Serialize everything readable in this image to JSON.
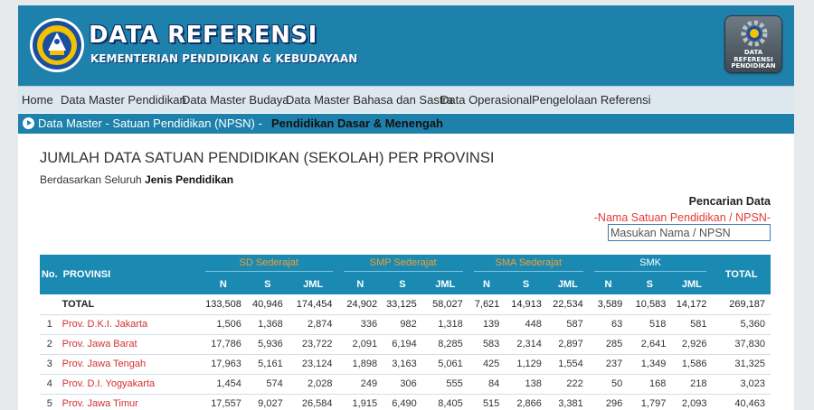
{
  "header": {
    "title": "DATA REFERENSI",
    "subtitle": "KEMENTERIAN PENDIDIKAN & KEBUDAYAAN",
    "badge_lines": [
      "DATA",
      "REFERENSI",
      "PENDIDIKAN"
    ]
  },
  "nav": {
    "items": [
      "Home",
      "Data Master Pendidikan",
      "Data Master Budaya",
      "Data Master Bahasa dan Sastra",
      "Data Operasional",
      "Pengelolaan Referensi"
    ]
  },
  "breadcrumb": {
    "path": "Data Master - Satuan Pendidikan (NPSN) -",
    "current": "Pendidikan Dasar & Menengah"
  },
  "main": {
    "heading": "JUMLAH DATA SATUAN PENDIDIKAN (SEKOLAH) PER PROVINSI",
    "sub_prefix": "Berdasarkan Seluruh",
    "sub_bold": "Jenis Pendidikan"
  },
  "search": {
    "title": "Pencarian Data",
    "subtitle": "-Nama Satuan Pendidikan / NPSN-",
    "placeholder": "Masukan Nama / NPSN"
  },
  "table": {
    "col_no": "No.",
    "col_prov": "PROVINSI",
    "groups": [
      "SD Sederajat",
      "SMP Sederajat",
      "SMA Sederajat",
      "SMK"
    ],
    "sub_cols": [
      "N",
      "S",
      "JML"
    ],
    "col_total": "TOTAL",
    "total_row": {
      "no": "",
      "prov": "TOTAL",
      "values": [
        "133,508",
        "40,946",
        "174,454",
        "24,902",
        "33,125",
        "58,027",
        "7,621",
        "14,913",
        "22,534",
        "3,589",
        "10,583",
        "14,172",
        "269,187"
      ]
    },
    "rows": [
      {
        "no": "1",
        "prov": "Prov. D.K.I. Jakarta",
        "values": [
          "1,506",
          "1,368",
          "2,874",
          "336",
          "982",
          "1,318",
          "139",
          "448",
          "587",
          "63",
          "518",
          "581",
          "5,360"
        ]
      },
      {
        "no": "2",
        "prov": "Prov. Jawa Barat",
        "values": [
          "17,786",
          "5,936",
          "23,722",
          "2,091",
          "6,194",
          "8,285",
          "583",
          "2,314",
          "2,897",
          "285",
          "2,641",
          "2,926",
          "37,830"
        ]
      },
      {
        "no": "3",
        "prov": "Prov. Jawa Tengah",
        "values": [
          "17,963",
          "5,161",
          "23,124",
          "1,898",
          "3,163",
          "5,061",
          "425",
          "1,129",
          "1,554",
          "237",
          "1,349",
          "1,586",
          "31,325"
        ]
      },
      {
        "no": "4",
        "prov": "Prov. D.I. Yogyakarta",
        "values": [
          "1,454",
          "574",
          "2,028",
          "249",
          "306",
          "555",
          "84",
          "138",
          "222",
          "50",
          "168",
          "218",
          "3,023"
        ]
      },
      {
        "no": "5",
        "prov": "Prov. Jawa Timur",
        "values": [
          "17,557",
          "9,027",
          "26,584",
          "1,915",
          "6,490",
          "8,405",
          "515",
          "2,866",
          "3,381",
          "296",
          "1,797",
          "2,093",
          "40,463"
        ]
      }
    ]
  }
}
